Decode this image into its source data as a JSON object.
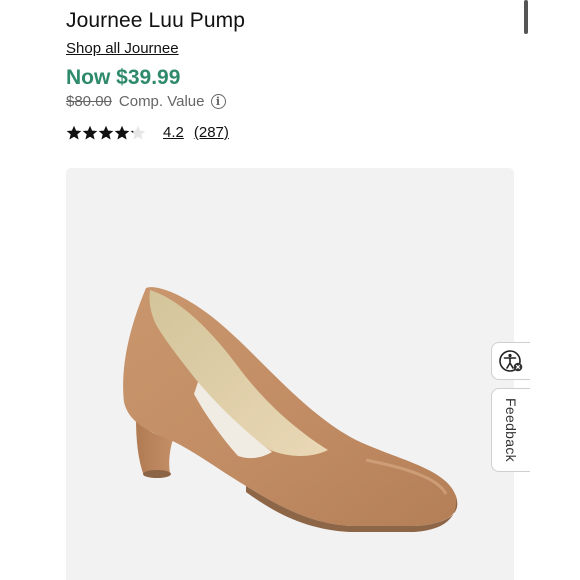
{
  "product": {
    "title": "Journee Luu Pump",
    "brand_link": "Shop all Journee",
    "now_price": "Now $39.99",
    "comp_price": "$80.00",
    "comp_label": "Comp. Value",
    "rating": "4.2",
    "review_count": "(287)",
    "rating_value": 4.2,
    "rating_max": 5
  },
  "feedback": {
    "label": "Feedback"
  },
  "icons": {
    "info": "info-icon",
    "accessibility": "accessibility-icon",
    "star": "star-icon"
  },
  "colors": {
    "price_green": "#2e8a6a",
    "image_bg": "#f3f2f2",
    "shoe_tan": "#c28e66"
  }
}
